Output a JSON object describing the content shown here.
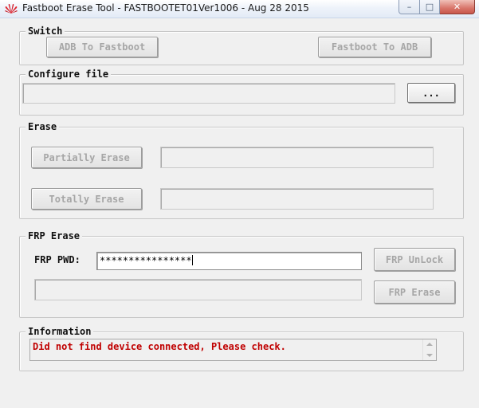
{
  "window": {
    "title": "Fastboot Erase Tool - FASTBOOTET01Ver1006 - Aug 28 2015",
    "controls": {
      "minimize": "–",
      "maximize": "□",
      "close": "✕"
    }
  },
  "switch": {
    "label": "Switch",
    "adb_to_fastboot": "ADB To Fastboot",
    "fastboot_to_adb": "Fastboot To ADB"
  },
  "configure": {
    "label": "Configure file",
    "path_value": "",
    "browse_label": "..."
  },
  "erase": {
    "label": "Erase",
    "partially_label": "Partially Erase",
    "partially_value": "",
    "totally_label": "Totally Erase",
    "totally_value": ""
  },
  "frp": {
    "label": "FRP Erase",
    "pwd_label": "FRP PWD:",
    "pwd_value": "****************",
    "unlock_label": "FRP UnLock",
    "status_value": "",
    "erase_label": "FRP Erase"
  },
  "information": {
    "label": "Information",
    "message": "Did not find device connected, Please check."
  },
  "colors": {
    "message_color": "#c00000",
    "window_bg": "#f0f0f0"
  }
}
